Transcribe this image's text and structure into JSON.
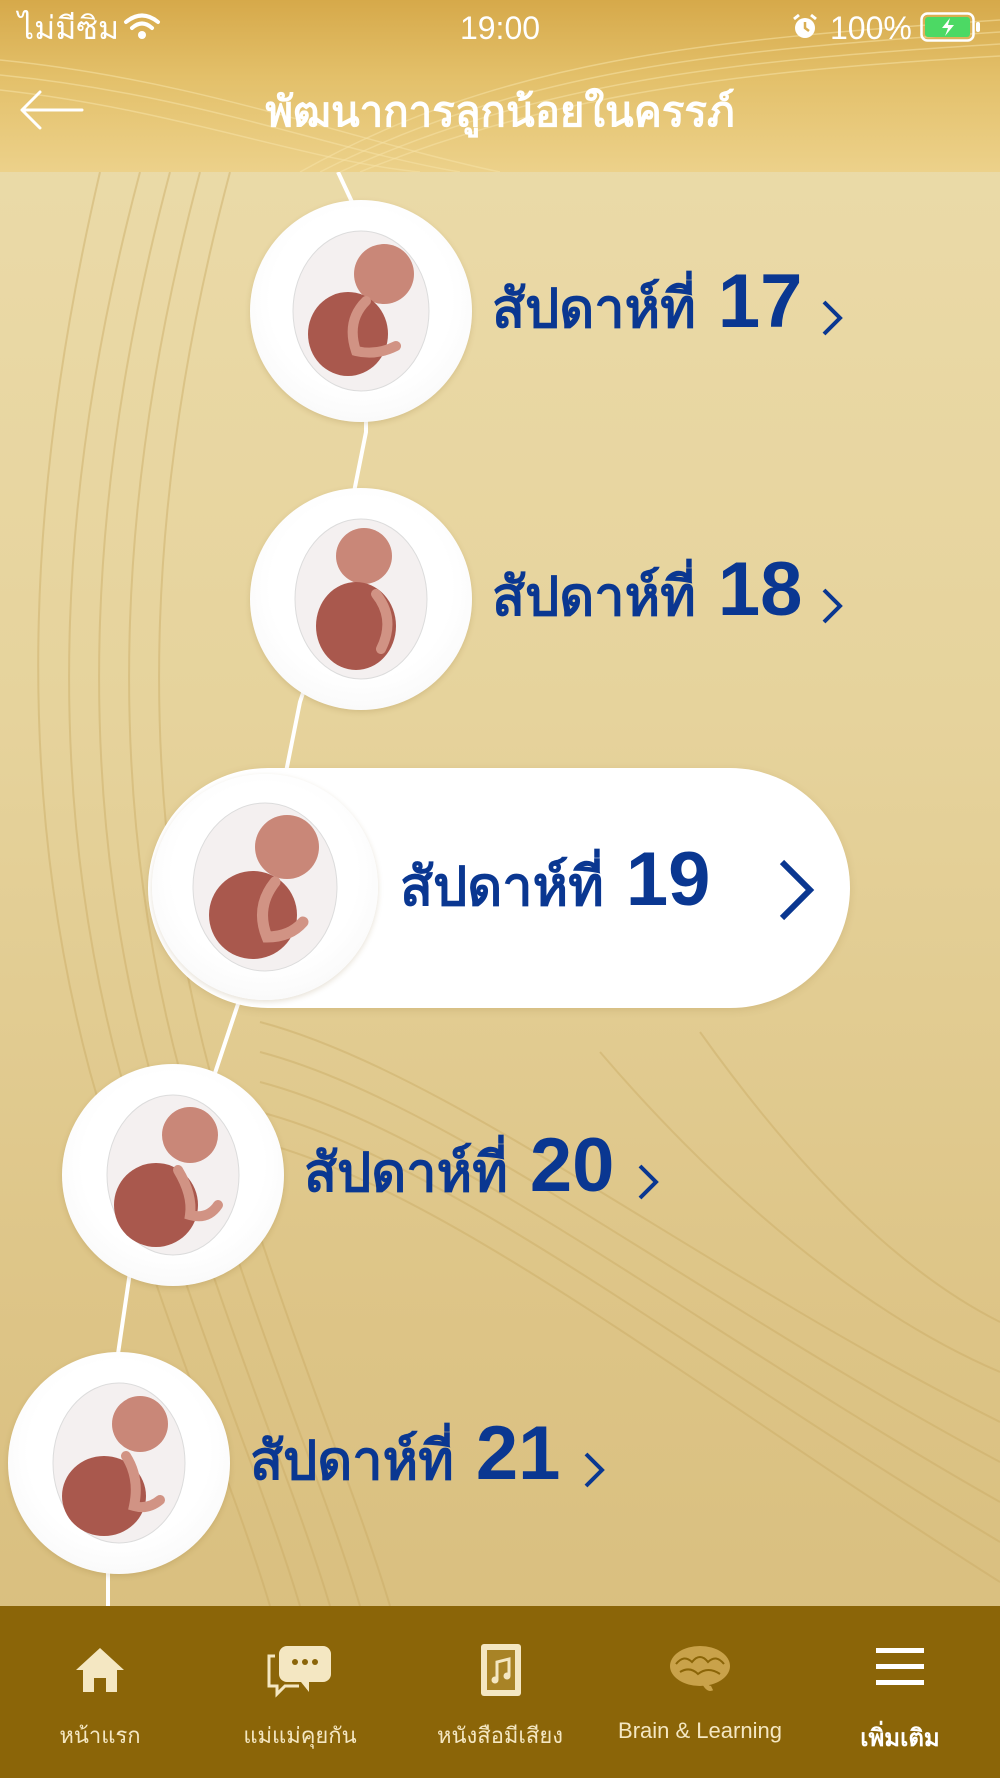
{
  "status_bar": {
    "carrier": "ไม่มีซิม",
    "time": "19:00",
    "battery": "100%"
  },
  "header": {
    "title": "พัฒนาการลูกน้อยในครรภ์",
    "back_icon": "arrow-left-icon"
  },
  "weeks": [
    {
      "prefix": "สัปดาห์ที่",
      "number": "17",
      "selected": false
    },
    {
      "prefix": "สัปดาห์ที่",
      "number": "18",
      "selected": false
    },
    {
      "prefix": "สัปดาห์ที่",
      "number": "19",
      "selected": true
    },
    {
      "prefix": "สัปดาห์ที่",
      "number": "20",
      "selected": false
    },
    {
      "prefix": "สัปดาห์ที่",
      "number": "21",
      "selected": false
    }
  ],
  "tabs": [
    {
      "label": "หน้าแรก",
      "icon": "home-icon"
    },
    {
      "label": "แม่แม่คุยกัน",
      "icon": "chat-icon"
    },
    {
      "label": "หนังสือมีเสียง",
      "icon": "audio-book-icon"
    },
    {
      "label": "Brain & Learning",
      "icon": "brain-icon"
    },
    {
      "label": "เพิ่มเติม",
      "icon": "menu-icon",
      "active": true
    }
  ],
  "colors": {
    "accent": "#0a3791",
    "tabbar": "#8b6508",
    "header_gold": "#e0b95f",
    "background": "#e6d39c"
  }
}
